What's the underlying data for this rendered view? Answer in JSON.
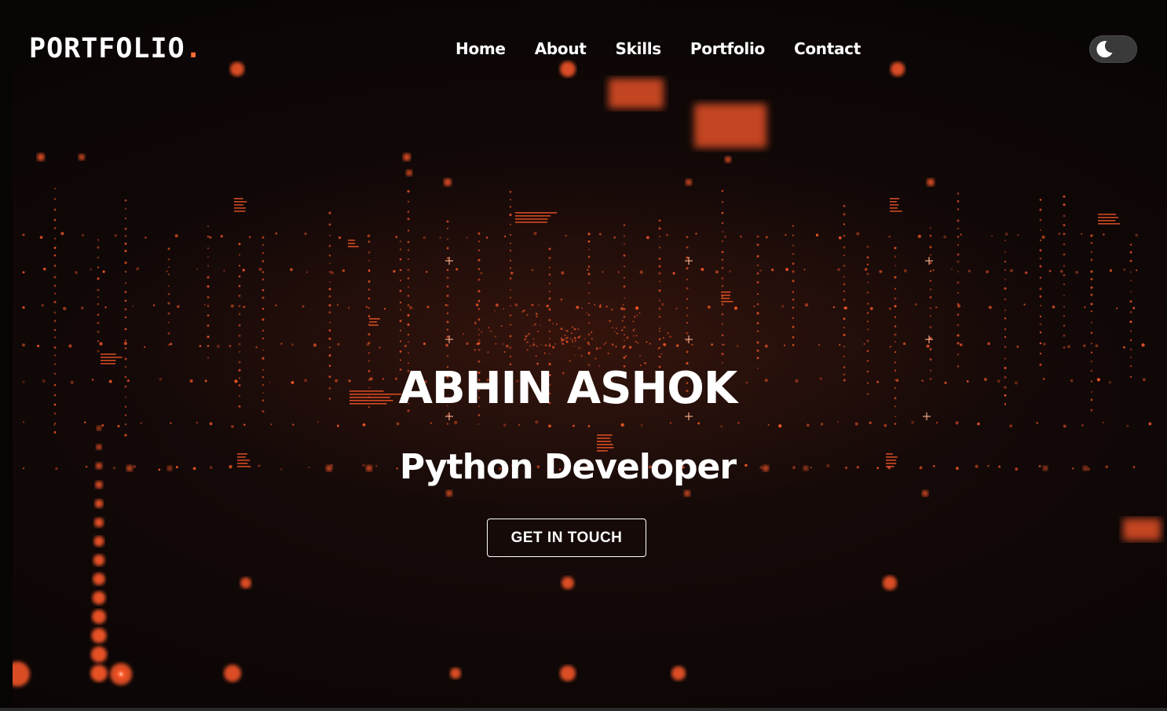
{
  "header": {
    "brand": "PORTFOLIO",
    "brand_dot": ".",
    "nav": [
      {
        "label": "Home"
      },
      {
        "label": "About"
      },
      {
        "label": "Skills"
      },
      {
        "label": "Portfolio"
      },
      {
        "label": "Contact"
      }
    ],
    "theme_toggle_icon": "moon-icon"
  },
  "hero": {
    "name": "ABHIN ASHOK",
    "role": "Python Developer",
    "cta_label": "GET IN TOUCH"
  },
  "colors": {
    "accent": "#ff6b35",
    "background": "#120807",
    "text": "#ffffff",
    "particle": "#ff5a2a"
  }
}
